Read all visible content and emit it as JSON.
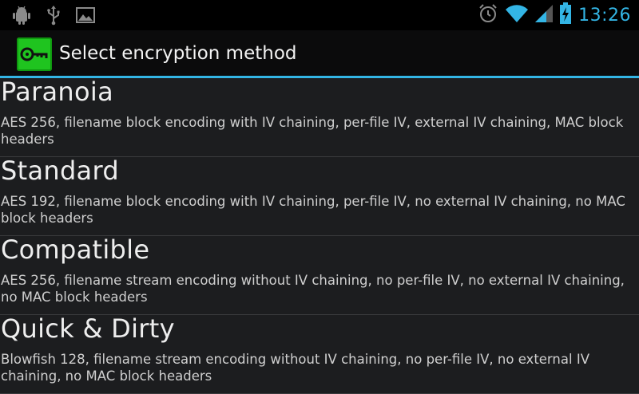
{
  "status_bar": {
    "time": "13:26",
    "left_icons": [
      "android-debug-icon",
      "usb-icon",
      "image-icon"
    ],
    "right_icons": [
      "alarm-icon",
      "wifi-icon",
      "signal-icon",
      "battery-charging-icon"
    ]
  },
  "action_bar": {
    "title": "Select encryption method",
    "app_icon": "key-icon"
  },
  "methods": [
    {
      "name": "Paranoia",
      "description": "AES 256, filename block encoding with IV chaining, per-file IV, external IV chaining, MAC block headers"
    },
    {
      "name": "Standard",
      "description": "AES 192, filename block encoding with IV chaining, per-file IV, no external IV chaining, no MAC block headers"
    },
    {
      "name": "Compatible",
      "description": "AES 256, filename stream encoding without IV chaining, no per-file IV, no external IV chaining, no MAC block headers"
    },
    {
      "name": "Quick & Dirty",
      "description": "Blowfish 128, filename stream encoding without IV chaining, no per-file IV, no external IV chaining, no MAC block headers"
    }
  ],
  "colors": {
    "accent": "#33b5e5",
    "app_icon_bg": "#1fc41f"
  }
}
